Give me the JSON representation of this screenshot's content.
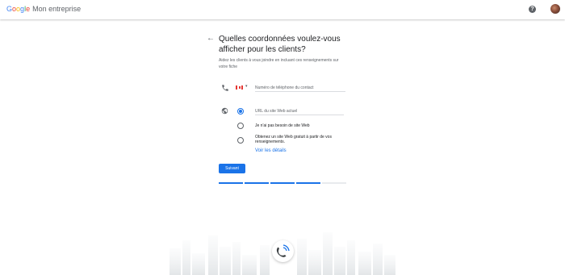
{
  "header": {
    "logo_brand": [
      "G",
      "o",
      "o",
      "g",
      "l",
      "e"
    ],
    "logo_product": "Mon entreprise",
    "help_icon": "help-icon",
    "avatar_icon": "avatar"
  },
  "page": {
    "back_icon": "arrow-back-icon",
    "back_glyph": "←",
    "title": "Quelles coordonnées voulez-vous afficher pour les clients?",
    "subtitle": "Aidez les clients à vous joindre en incluant ces renseignements sur votre fiche"
  },
  "phone": {
    "icon": "phone-icon",
    "country_flag": "flag-canada-icon",
    "caret": "▾",
    "placeholder": "Numéro de téléphone du contact",
    "value": ""
  },
  "website": {
    "icon": "globe-icon",
    "options": [
      {
        "label": "URL du site Web actuel",
        "selected": true,
        "kind": "input"
      },
      {
        "label": "Je n'ai pas besoin de site Web",
        "selected": false
      },
      {
        "label": "Obtenez un site Web gratuit à partir de vos renseignements.",
        "selected": false
      }
    ],
    "details_link": "Voir les détails"
  },
  "actions": {
    "next_label": "Suivant"
  },
  "progress": {
    "segments_total": 5,
    "segments_done": 4
  },
  "colors": {
    "accent": "#1a73e8",
    "text": "#202124",
    "secondary": "#5f6368"
  }
}
